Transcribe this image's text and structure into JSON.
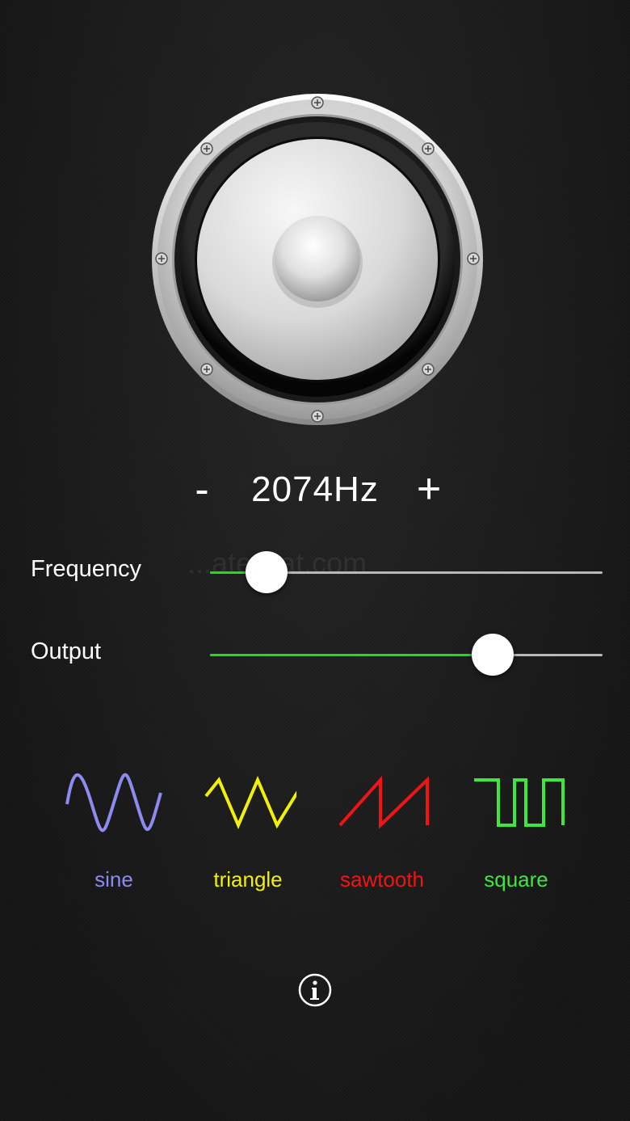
{
  "frequency_display": {
    "minus_label": "-",
    "value_text": "2074Hz",
    "plus_label": "+"
  },
  "sliders": {
    "frequency": {
      "label": "Frequency",
      "level": 0.145
    },
    "output": {
      "label": "Output",
      "level": 0.72
    }
  },
  "watermark": "...ateStat.com",
  "waveforms": [
    {
      "label": "sine",
      "icon": "sine-wave-icon",
      "color": "#8c8cf0"
    },
    {
      "label": "triangle",
      "icon": "triangle-wave-icon",
      "color": "#f2f200"
    },
    {
      "label": "sawtooth",
      "icon": "sawtooth-wave-icon",
      "color": "#f01414"
    },
    {
      "label": "square",
      "icon": "square-wave-icon",
      "color": "#3ee63e"
    }
  ],
  "info": {
    "icon": "info-icon"
  },
  "colors": {
    "slider_fill": "#19e019",
    "slider_track": "#b8b8b8"
  }
}
